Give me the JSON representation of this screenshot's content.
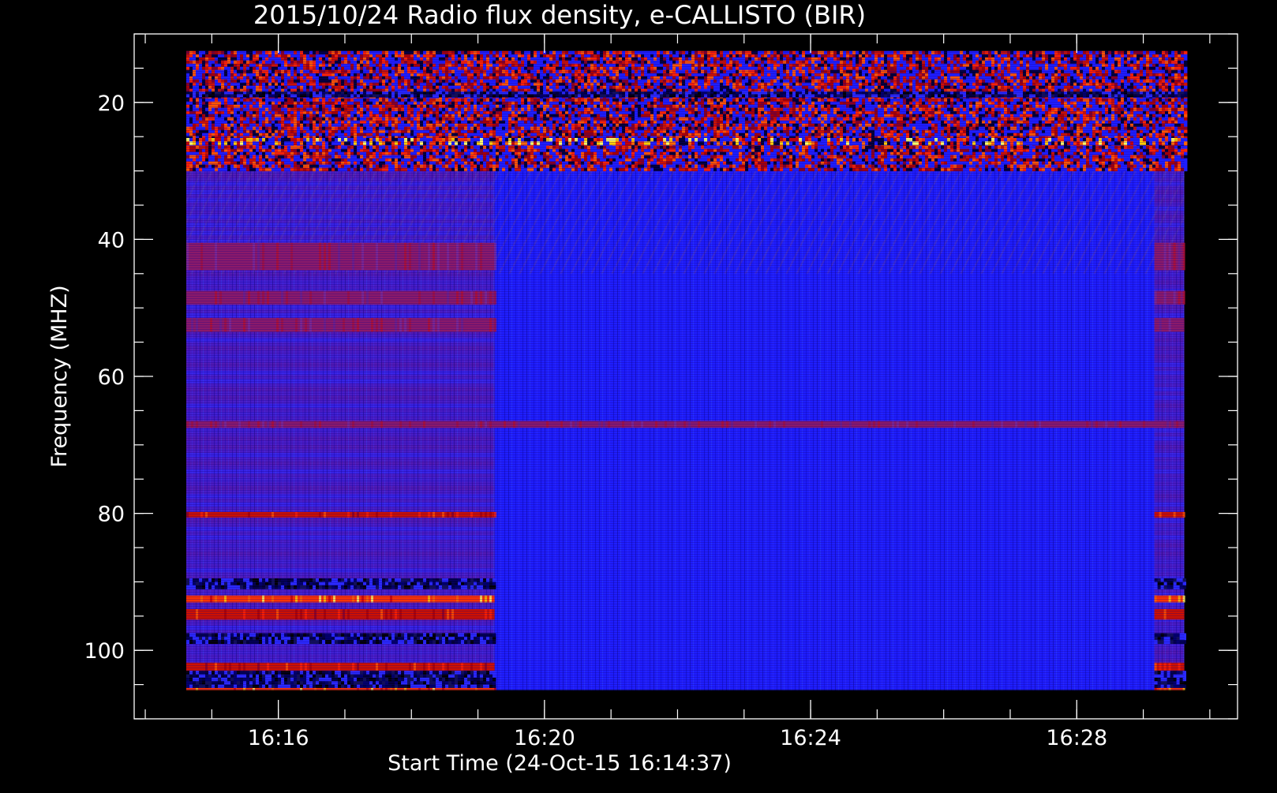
{
  "chart_data": {
    "type": "heatmap",
    "title": "2015/10/24  Radio flux density, e-CALLISTO (BIR)",
    "xlabel": "Start Time (24-Oct-15 16:14:37)",
    "ylabel": "Frequency (MHZ)",
    "x_axis": {
      "unit": "time",
      "range": [
        "16:13:50",
        "16:30:25"
      ],
      "data_range": [
        "16:14:37",
        "16:29:37"
      ],
      "major_ticks": [
        "16:16",
        "16:20",
        "16:24",
        "16:28"
      ],
      "minor_tick_interval_seconds": 60
    },
    "y_axis": {
      "unit": "MHz",
      "range": [
        10,
        110
      ],
      "inverted": true,
      "data_range": [
        12.5,
        105.8
      ],
      "major_ticks": [
        20,
        40,
        60,
        80,
        100
      ],
      "minor_tick_interval": 5
    },
    "segments": [
      {
        "start": "16:14:37",
        "end": "16:19:15",
        "baseline": "elevated"
      },
      {
        "start": "16:19:15",
        "end": "16:29:10",
        "baseline": "quiet"
      },
      {
        "start": "16:29:10",
        "end": "16:29:37",
        "baseline": "elevated"
      }
    ],
    "bands": [
      {
        "freq_min": 12.5,
        "freq_max": 30,
        "intensity": "high",
        "pattern": "bursty",
        "segment": "all"
      },
      {
        "freq_min": 25.2,
        "freq_max": 26.2,
        "intensity": "very-high",
        "pattern": "bursty",
        "segment": "all"
      },
      {
        "freq_min": 18.4,
        "freq_max": 19.2,
        "intensity": "low",
        "pattern": "dark",
        "segment": "all"
      },
      {
        "freq_min": 40.5,
        "freq_max": 44.5,
        "intensity": "medium",
        "segment": "elevated"
      },
      {
        "freq_min": 47.5,
        "freq_max": 49.5,
        "intensity": "medium",
        "segment": "elevated"
      },
      {
        "freq_min": 51.5,
        "freq_max": 53.5,
        "intensity": "medium",
        "segment": "elevated"
      },
      {
        "freq_min": 66.5,
        "freq_max": 67.5,
        "intensity": "medium",
        "segment": "all"
      },
      {
        "freq_min": 79.8,
        "freq_max": 80.6,
        "intensity": "high",
        "segment": "elevated"
      },
      {
        "freq_min": 89.5,
        "freq_max": 91,
        "intensity": "low",
        "pattern": "dark",
        "segment": "elevated"
      },
      {
        "freq_min": 92,
        "freq_max": 93,
        "intensity": "very-high",
        "segment": "elevated"
      },
      {
        "freq_min": 94,
        "freq_max": 95.5,
        "intensity": "high",
        "segment": "elevated"
      },
      {
        "freq_min": 97.5,
        "freq_max": 99,
        "intensity": "low",
        "pattern": "dark",
        "segment": "elevated"
      },
      {
        "freq_min": 101.8,
        "freq_max": 103,
        "intensity": "high",
        "segment": "elevated"
      },
      {
        "freq_min": 103,
        "freq_max": 105.5,
        "intensity": "low",
        "pattern": "dark",
        "segment": "elevated"
      },
      {
        "freq_min": 105.5,
        "freq_max": 105.8,
        "intensity": "very-high",
        "segment": "elevated"
      }
    ],
    "grid": false,
    "legend": "none"
  }
}
